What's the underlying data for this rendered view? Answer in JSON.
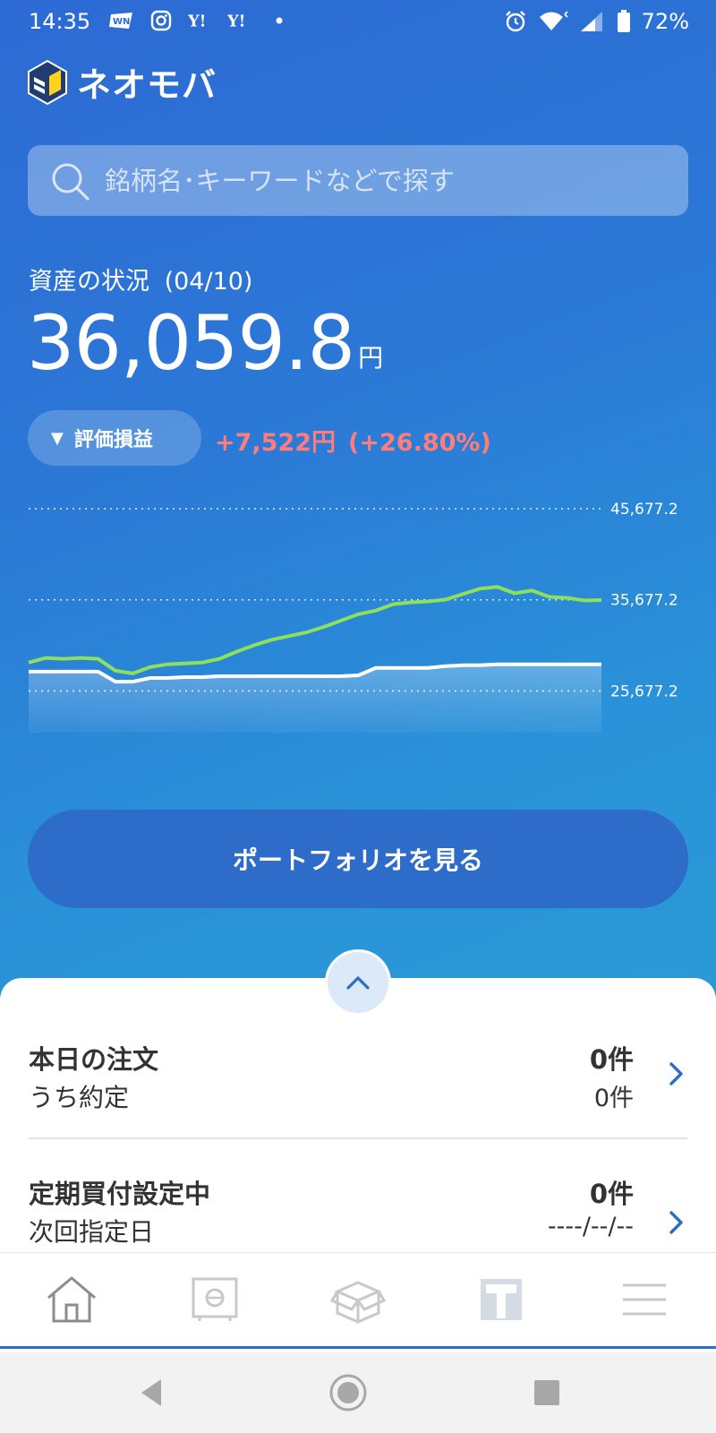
{
  "statusbar": {
    "time": "14:35",
    "left_icons": [
      "weathernews-icon",
      "instagram-icon",
      "yahoo-icon",
      "yahoo-icon",
      "dot-icon"
    ],
    "right_icons": [
      "alarm-icon",
      "wifi-icon",
      "signal-icon",
      "battery-icon"
    ],
    "battery": "72%"
  },
  "app": {
    "name": "ネオモバ",
    "brand_color": "#2a6fd0"
  },
  "search": {
    "placeholder": "銘柄名･キーワードなどで探す"
  },
  "assets": {
    "label": "資産の状況",
    "date": "(04/10)",
    "value": "36,059.8",
    "unit": "円"
  },
  "pl": {
    "toggle_label": "評価損益",
    "amount": "+7,522円",
    "percent": "(+26.80%)",
    "color": "#ff7c7c"
  },
  "chart_data": {
    "type": "line",
    "y_ticks": [
      "45,677.2",
      "35,677.2",
      "25,677.2"
    ],
    "ylim": [
      22677.2,
      45677.2
    ],
    "grid": true,
    "series": [
      {
        "color": "#8ee05a",
        "values": [
          28800,
          29300,
          29200,
          29300,
          29200,
          27900,
          27600,
          28300,
          28600,
          28700,
          28800,
          29200,
          30000,
          30700,
          31300,
          31700,
          32100,
          32700,
          33400,
          34100,
          34500,
          35200,
          35400,
          35500,
          35700,
          36300,
          36900,
          37100,
          36400,
          36700,
          36000,
          35900,
          35600,
          35650
        ]
      },
      {
        "color": "#ffffff",
        "values": [
          27800,
          27800,
          27800,
          27800,
          27800,
          26700,
          26700,
          27100,
          27100,
          27200,
          27200,
          27300,
          27300,
          27300,
          27300,
          27300,
          27300,
          27300,
          27300,
          27400,
          28200,
          28200,
          28200,
          28200,
          28400,
          28500,
          28500,
          28600,
          28600,
          28600,
          28600,
          28600,
          28600,
          28600
        ]
      }
    ]
  },
  "portfolio_button": "ポートフォリオを見る",
  "orders": {
    "title": "本日の注文",
    "count": "0件",
    "sub_label": "うち約定",
    "sub_count": "0件"
  },
  "recurring": {
    "title": "定期買付設定中",
    "count": "0件",
    "sub_label": "次回指定日",
    "sub_value": "----/--/--"
  },
  "tabs": [
    "home-icon",
    "safe-icon",
    "box-icon",
    "t-point-icon",
    "menu-icon"
  ],
  "nav": [
    "back-icon",
    "home-circle-icon",
    "recents-icon"
  ]
}
